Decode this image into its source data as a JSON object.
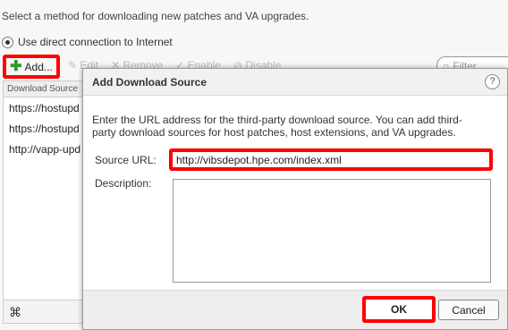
{
  "background": {
    "intro_text": "Select a method for downloading new patches and VA upgrades.",
    "radio_label": "Use direct connection to Internet",
    "toolbar": {
      "add_label": "Add...",
      "edit_label": "Edit",
      "remove_label": "Remove",
      "enable_label": "Enable",
      "disable_label": "Disable",
      "filter_placeholder": "Filter"
    },
    "grid": {
      "header": "Download Source",
      "rows": [
        "https://hostupd",
        "https://hostupd",
        "http://vapp-upd"
      ]
    }
  },
  "dialog": {
    "title": "Add Download Source",
    "help": "?",
    "description": "Enter the URL address for the third-party download source. You can add third-party download sources for host patches, host extensions, and VA upgrades.",
    "source_url_label": "Source URL:",
    "source_url_value": "http://vibsdepot.hpe.com/index.xml",
    "description_label": "Description:",
    "description_value": "",
    "ok_label": "OK",
    "cancel_label": "Cancel"
  },
  "colors": {
    "highlight": "#ff0000",
    "add_icon": "#2e9b2e"
  }
}
